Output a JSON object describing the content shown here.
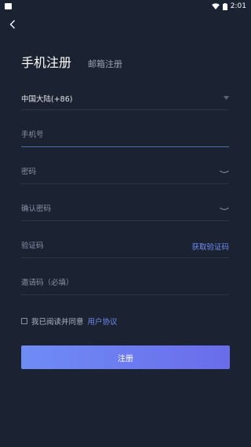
{
  "status_bar": {
    "time": "2:01"
  },
  "tabs": {
    "active_label": "手机注册",
    "inactive_label": "邮箱注册"
  },
  "form": {
    "country_value": "中国大陆(+86)",
    "phone_placeholder": "手机号",
    "password_placeholder": "密码",
    "confirm_password_placeholder": "确认密码",
    "code_placeholder": "验证码",
    "get_code_label": "获取验证码",
    "invite_placeholder": "邀请码（必填）"
  },
  "agreement": {
    "text": "我已阅读并同意",
    "link_label": "用户协议"
  },
  "submit_label": "注册",
  "colors": {
    "background": "#1b2232",
    "accent": "#6f8cf0",
    "button_start": "#6f8cf5",
    "button_end": "#6a6cea"
  }
}
